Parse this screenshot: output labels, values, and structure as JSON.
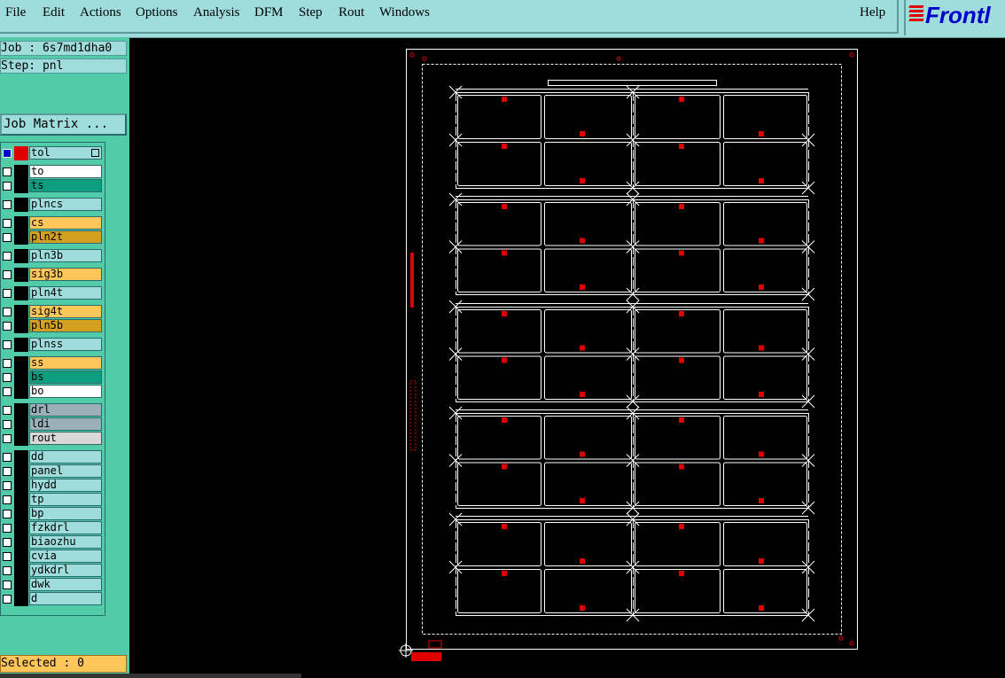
{
  "menu": {
    "file": "File",
    "edit": "Edit",
    "actions": "Actions",
    "options": "Options",
    "analysis": "Analysis",
    "dfm": "DFM",
    "step": "Step",
    "rout": "Rout",
    "windows": "Windows",
    "help": "Help"
  },
  "logo": {
    "text": "Frontl"
  },
  "job": {
    "label": "Job : 6s7md1dha0",
    "step": "Step: pnl",
    "matrix_button": "Job Matrix ..."
  },
  "layers": [
    {
      "name": "tol",
      "color": "#9fdcdc"
    },
    {
      "name": "to",
      "color": "#ffffff"
    },
    {
      "name": "ts",
      "color": "#0d9e80"
    },
    {
      "name": "plncs",
      "color": "#9fdcdc"
    },
    {
      "name": "cs",
      "color": "#ffc75a"
    },
    {
      "name": "pln2t",
      "color": "#d4a020"
    },
    {
      "name": "pln3b",
      "color": "#9fdcdc"
    },
    {
      "name": "sig3b",
      "color": "#ffc75a"
    },
    {
      "name": "pln4t",
      "color": "#9fdcdc"
    },
    {
      "name": "sig4t",
      "color": "#ffc75a"
    },
    {
      "name": "pln5b",
      "color": "#d4a020"
    },
    {
      "name": "plnss",
      "color": "#9fdcdc"
    },
    {
      "name": "ss",
      "color": "#ffc75a"
    },
    {
      "name": "bs",
      "color": "#0d9e80"
    },
    {
      "name": "bo",
      "color": "#ffffff"
    },
    {
      "name": "drl",
      "color": "#9ab0b8"
    },
    {
      "name": "ldi",
      "color": "#9ab0b8"
    },
    {
      "name": "rout",
      "color": "#d8d8d8"
    },
    {
      "name": "dd",
      "color": "#9fdcdc"
    },
    {
      "name": "panel",
      "color": "#9fdcdc"
    },
    {
      "name": "hydd",
      "color": "#9fdcdc"
    },
    {
      "name": "tp",
      "color": "#9fdcdc"
    },
    {
      "name": "bp",
      "color": "#9fdcdc"
    },
    {
      "name": "fzkdrl",
      "color": "#9fdcdc"
    },
    {
      "name": "biaozhu",
      "color": "#9fdcdc"
    },
    {
      "name": "cvia",
      "color": "#9fdcdc"
    },
    {
      "name": "ydkdrl",
      "color": "#9fdcdc"
    },
    {
      "name": "dwk",
      "color": "#9fdcdc"
    },
    {
      "name": "d",
      "color": "#9fdcdc"
    }
  ],
  "status": {
    "selected": "Selected : 0"
  },
  "colors": {
    "menubar": "#9fdcdc",
    "panel": "#52cca8",
    "marker": "#e00000",
    "outline": "#ffffff"
  }
}
